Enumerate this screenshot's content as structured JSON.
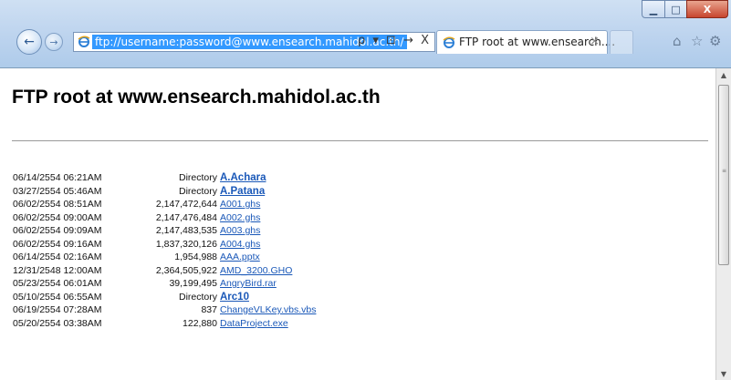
{
  "browser": {
    "address_url": "ftp://username:password@www.ensearch.mahidol.ac.th/",
    "address_tools": "ρ ▾ ⊡ → X",
    "tab_title": "FTP root at www.ensearch....",
    "tab_close": "×",
    "window_buttons": {
      "minimize": "▁",
      "maximize": "□",
      "close": "X"
    },
    "toolbar_icons": [
      "home-icon",
      "favorites-star-icon",
      "tools-gear-icon"
    ]
  },
  "page": {
    "heading": "FTP root at www.ensearch.mahidol.ac.th",
    "entries": [
      {
        "date": "06/14/2554 06:21AM",
        "size": "Directory",
        "name": "A.Achara",
        "is_dir": true
      },
      {
        "date": "03/27/2554 05:46AM",
        "size": "Directory",
        "name": "A.Patana",
        "is_dir": true
      },
      {
        "date": "06/02/2554 08:51AM",
        "size": "2,147,472,644",
        "name": "A001.ghs",
        "is_dir": false
      },
      {
        "date": "06/02/2554 09:00AM",
        "size": "2,147,476,484",
        "name": "A002.ghs",
        "is_dir": false
      },
      {
        "date": "06/02/2554 09:09AM",
        "size": "2,147,483,535",
        "name": "A003.ghs",
        "is_dir": false
      },
      {
        "date": "06/02/2554 09:16AM",
        "size": "1,837,320,126",
        "name": "A004.ghs",
        "is_dir": false
      },
      {
        "date": "06/14/2554 02:16AM",
        "size": "1,954,988",
        "name": "AAA.pptx",
        "is_dir": false
      },
      {
        "date": "12/31/2548 12:00AM",
        "size": "2,364,505,922",
        "name": "AMD_3200.GHO",
        "is_dir": false
      },
      {
        "date": "05/23/2554 06:01AM",
        "size": "39,199,495",
        "name": "AngryBird.rar",
        "is_dir": false
      },
      {
        "date": "05/10/2554 06:55AM",
        "size": "Directory",
        "name": "Arc10",
        "is_dir": true
      },
      {
        "date": "06/19/2554 07:28AM",
        "size": "837",
        "name": "ChangeVLKey.vbs.vbs",
        "is_dir": false
      },
      {
        "date": "05/20/2554 03:38AM",
        "size": "122,880",
        "name": "DataProject.exe",
        "is_dir": false
      }
    ]
  },
  "colors": {
    "link": "#1a58b8",
    "chrome": "#bcd3ee",
    "selection": "#3399ff"
  }
}
